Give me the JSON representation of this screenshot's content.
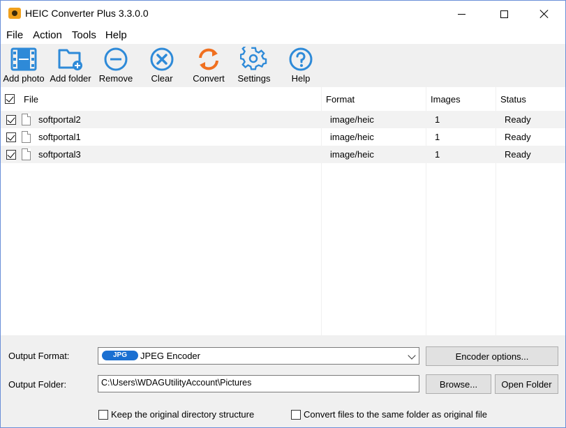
{
  "window": {
    "title": "HEIC Converter Plus 3.3.0.0",
    "accent_color": "#f0a01c"
  },
  "menu": [
    "File",
    "Action",
    "Tools",
    "Help"
  ],
  "toolbar": {
    "add_photo": "Add photo",
    "add_folder": "Add folder",
    "remove": "Remove",
    "clear": "Clear",
    "convert": "Convert",
    "settings": "Settings",
    "help": "Help",
    "icon_color": "#2e8ad8",
    "convert_color": "#f07020"
  },
  "table": {
    "headers": {
      "file": "File",
      "format": "Format",
      "images": "Images",
      "status": "Status"
    },
    "select_all_checked": true,
    "rows": [
      {
        "checked": true,
        "file": "softportal2",
        "format": "image/heic",
        "images": "1",
        "status": "Ready"
      },
      {
        "checked": true,
        "file": "softportal1",
        "format": "image/heic",
        "images": "1",
        "status": "Ready"
      },
      {
        "checked": true,
        "file": "softportal3",
        "format": "image/heic",
        "images": "1",
        "status": "Ready"
      }
    ]
  },
  "output": {
    "format_label": "Output Format:",
    "format_badge": "JPG",
    "format_value": "JPEG Encoder",
    "encoder_options": "Encoder options...",
    "folder_label": "Output Folder:",
    "folder_value": "C:\\Users\\WDAGUtilityAccount\\Pictures",
    "browse": "Browse...",
    "open_folder": "Open Folder",
    "keep_structure": "Keep the original directory structure",
    "keep_structure_checked": false,
    "same_folder": "Convert files to the same folder as original file",
    "same_folder_checked": false
  }
}
